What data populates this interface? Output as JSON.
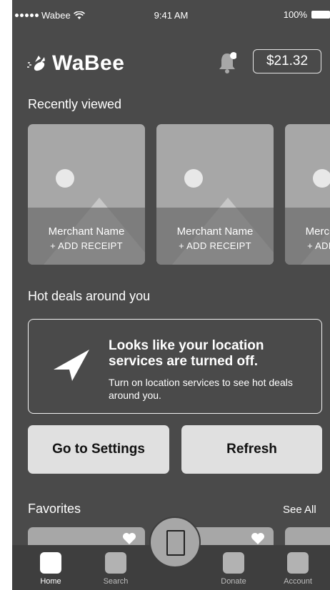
{
  "status_bar": {
    "carrier": "Wabee",
    "time": "9:41 AM",
    "battery": "100%"
  },
  "header": {
    "app_name": "WaBee",
    "balance": "$21.32",
    "notification_icon": "bell-icon"
  },
  "recently_viewed": {
    "title": "Recently viewed",
    "cards": [
      {
        "merchant": "Merchant Name",
        "action": "+ ADD RECEIPT"
      },
      {
        "merchant": "Merchant Name",
        "action": "+ ADD RECEIPT"
      },
      {
        "merchant": "Merchant Name",
        "action": "+ ADD RECEIPT"
      }
    ]
  },
  "hot_deals": {
    "title": "Hot deals around you",
    "message_title": "Looks like your location services are turned off.",
    "message_body": "Turn on location services to see hot deals around you.",
    "settings_button": "Go to Settings",
    "refresh_button": "Refresh"
  },
  "favorites": {
    "title": "Favorites",
    "see_all": "See All"
  },
  "tabbar": {
    "items": [
      {
        "label": "Home",
        "active": true
      },
      {
        "label": "Search",
        "active": false
      },
      {
        "label": "Donate",
        "active": false
      },
      {
        "label": "Account",
        "active": false
      }
    ],
    "center_icon": "receipt-scan-icon"
  },
  "colors": {
    "background": "#4a4a4a",
    "card": "#a7a7a7",
    "button": "#e0e0e0",
    "tabbar": "#3e3e3e"
  }
}
